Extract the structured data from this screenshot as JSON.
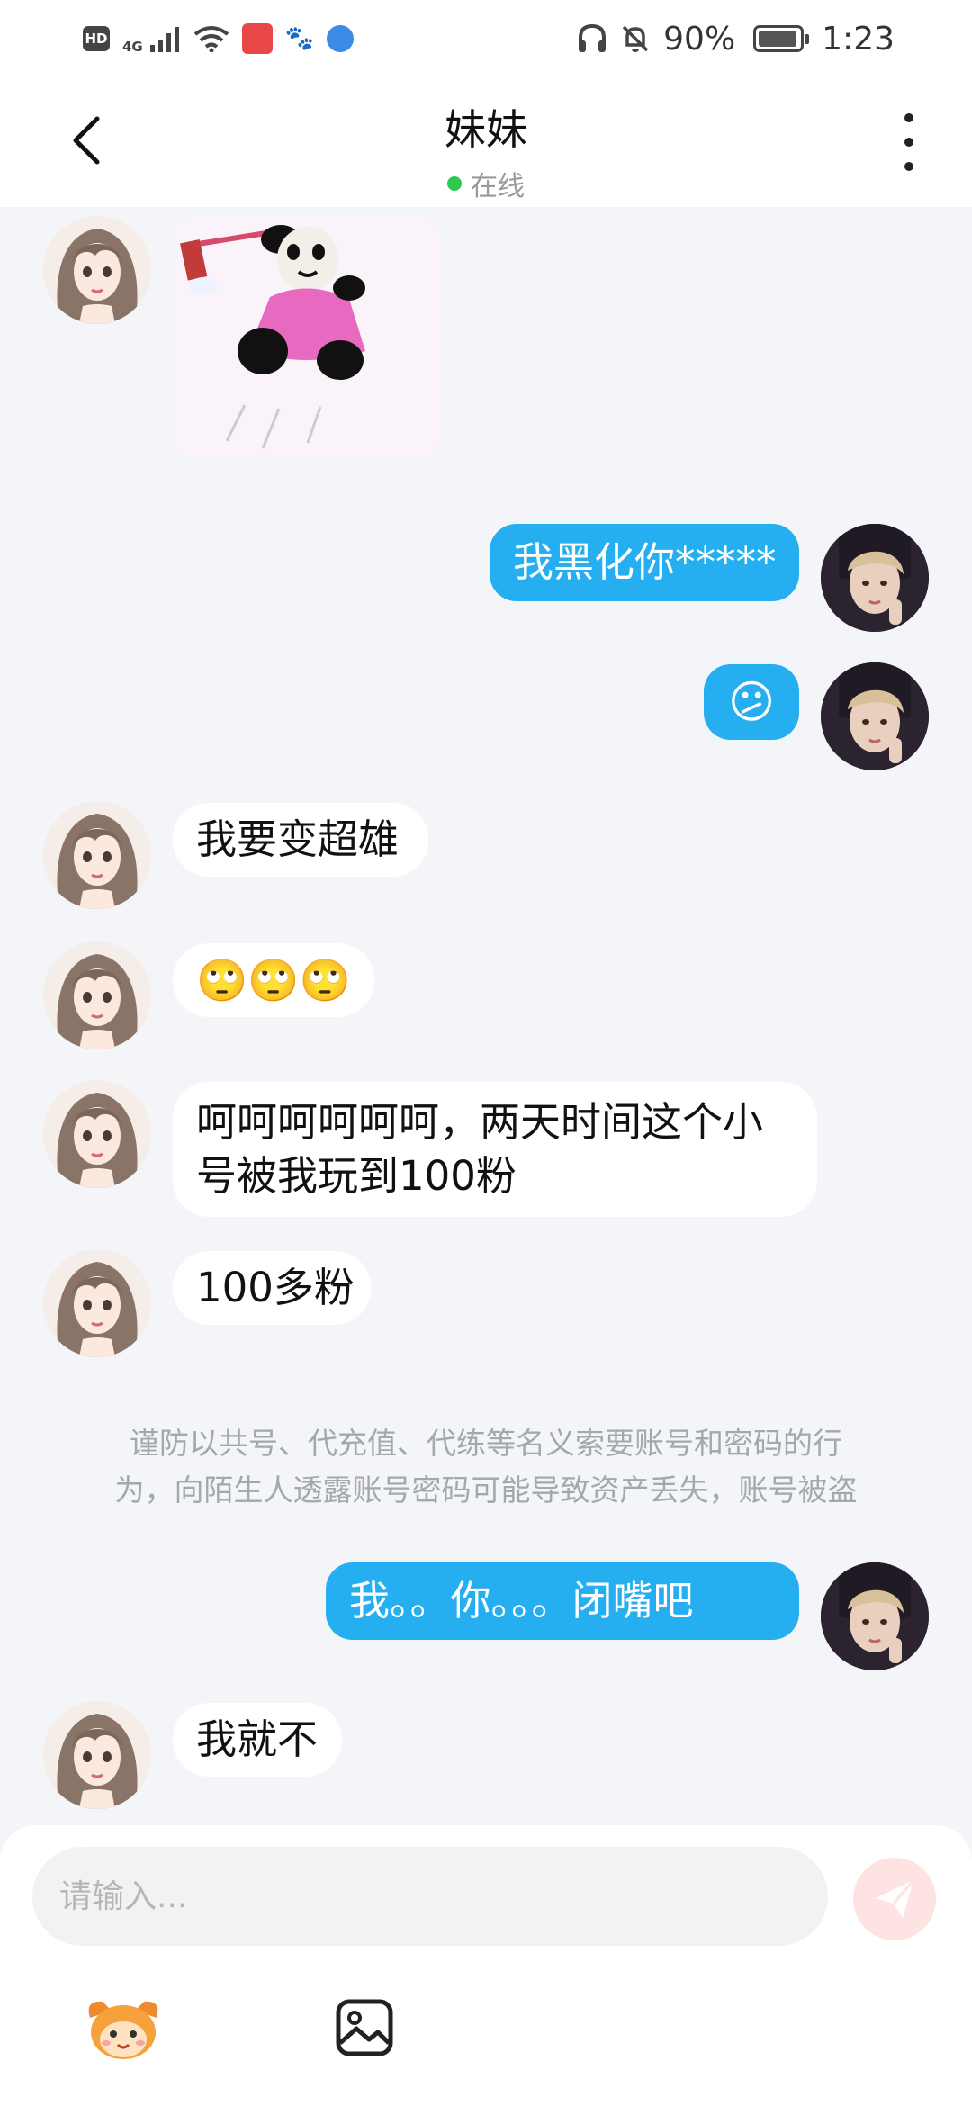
{
  "status_bar": {
    "hd": "HD",
    "network": "4G",
    "battery_percent": "90%",
    "time": "1:23"
  },
  "header": {
    "title": "妹妹",
    "status": "在线"
  },
  "messages": [
    {
      "side": "in",
      "type": "sticker"
    },
    {
      "side": "out",
      "type": "text",
      "text": "我黑化你*****"
    },
    {
      "side": "out",
      "type": "emoji",
      "text": "😕"
    },
    {
      "side": "in",
      "type": "text",
      "text": "我要变超雄"
    },
    {
      "side": "in",
      "type": "emoji",
      "text": "🙄🙄🙄"
    },
    {
      "side": "in",
      "type": "text",
      "line1": "呵呵呵呵呵呵，两天时间这个小",
      "line2": "号被我玩到100粉"
    },
    {
      "side": "in",
      "type": "text",
      "text": "100多粉"
    },
    {
      "side": "out",
      "type": "text",
      "text": "我。。你。。。闭嘴吧"
    },
    {
      "side": "in",
      "type": "text",
      "text": "我就不"
    }
  ],
  "notice": {
    "line1": "谨防以共号、代充值、代练等名义索要账号和密码的行",
    "line2": "为，向陌生人透露账号密码可能导致资产丢失，账号被盗"
  },
  "composer": {
    "placeholder": "请输入...",
    "value": ""
  },
  "icons": {
    "back": "chevron-left-icon",
    "more": "more-vertical-icon",
    "send": "send-plane-icon",
    "mascot": "mascot-emoji-icon",
    "image": "image-picker-icon"
  },
  "colors": {
    "accent": "#25aef0",
    "online": "#2dc84d",
    "background": "#f3f5f8",
    "send_disabled": "#fde3e1"
  }
}
